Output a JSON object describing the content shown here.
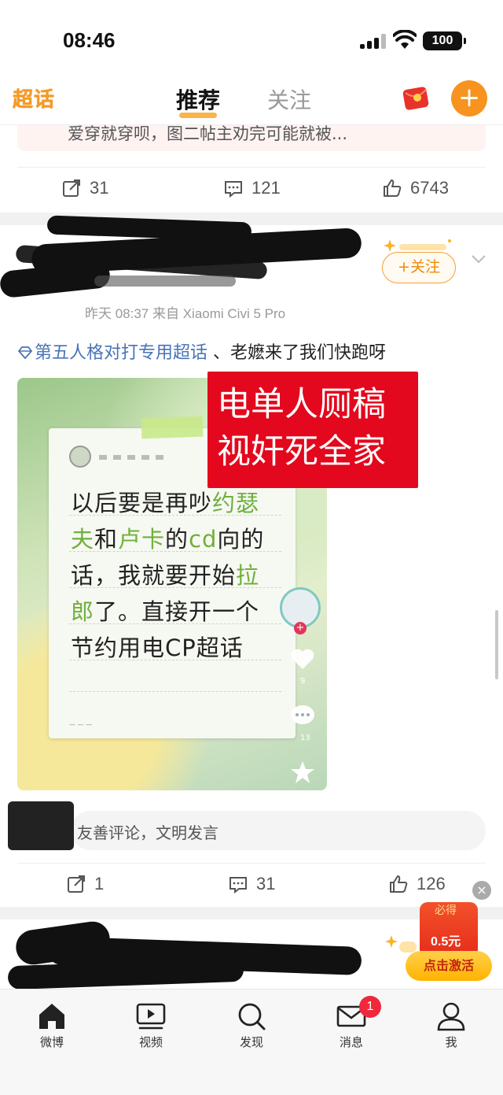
{
  "status_bar": {
    "time": "08:46",
    "battery": "100"
  },
  "top_nav": {
    "logo": "超话",
    "tabs": [
      {
        "label": "推荐",
        "active": true
      },
      {
        "label": "关注",
        "active": false
      }
    ],
    "plus_label": "+"
  },
  "previous_post": {
    "quote_text": "爱穿就穿呗，图二帖主劝完可能就被...",
    "actions": {
      "repost": "31",
      "comment": "121",
      "like": "6743"
    }
  },
  "post": {
    "meta": "昨天 08:37  来自 Xiaomi Civi 5 Pro",
    "follow_label": "+关注",
    "topic": "第五人格对打专用超话",
    "text": "、老嬷来了我们快跑呀",
    "image": {
      "note_lines": [
        {
          "parts": [
            {
              "t": "以后要是再吵",
              "g": false
            },
            {
              "t": "约瑟",
              "g": true
            }
          ]
        },
        {
          "parts": [
            {
              "t": "夫",
              "g": true
            },
            {
              "t": "和",
              "g": false
            },
            {
              "t": "卢卡",
              "g": true
            },
            {
              "t": "的",
              "g": false
            },
            {
              "t": "cd",
              "g": true
            },
            {
              "t": "向的",
              "g": false
            }
          ]
        },
        {
          "parts": [
            {
              "t": "话，我就要开始",
              "g": false
            },
            {
              "t": "拉",
              "g": true
            }
          ]
        },
        {
          "parts": [
            {
              "t": "郎",
              "g": true
            },
            {
              "t": "了。直接开一个",
              "g": false
            }
          ]
        },
        {
          "parts": [
            {
              "t": "节约用电CP超话",
              "g": false
            }
          ]
        }
      ],
      "side_counts": {
        "likes": "9",
        "comments": "13"
      }
    },
    "overlay_text": [
      "电单人厕稿",
      "视奸死全家"
    ],
    "comment_placeholder": "友善评论，文明发言",
    "actions": {
      "repost": "1",
      "comment": "31",
      "like": "126"
    }
  },
  "promo": {
    "label": "必得",
    "amount": "0.5元",
    "button": "点击激活",
    "close": "×"
  },
  "tabbar": {
    "items": [
      {
        "label": "微博",
        "icon": "home-icon"
      },
      {
        "label": "视频",
        "icon": "video-icon"
      },
      {
        "label": "发现",
        "icon": "search-icon"
      },
      {
        "label": "消息",
        "icon": "mail-icon",
        "badge": "1"
      },
      {
        "label": "我",
        "icon": "profile-icon"
      }
    ]
  },
  "colors": {
    "accent": "#f7931e",
    "topic_link": "#4a73b8",
    "overlay_red": "#e3081d"
  }
}
